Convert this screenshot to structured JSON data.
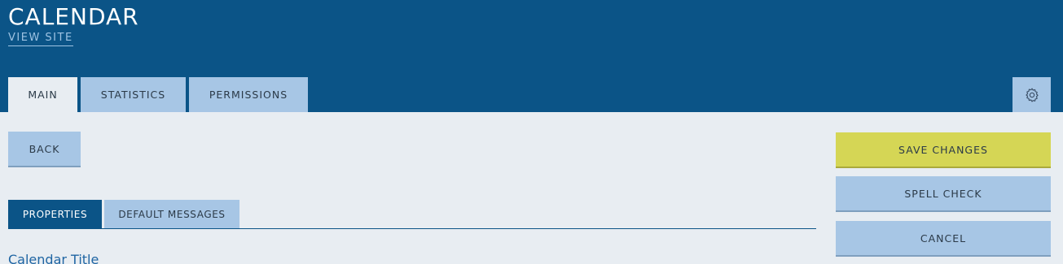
{
  "header": {
    "title": "CALENDAR",
    "view_site_label": "VIEW SITE"
  },
  "tabs": [
    {
      "label": "MAIN",
      "active": true
    },
    {
      "label": "STATISTICS",
      "active": false
    },
    {
      "label": "PERMISSIONS",
      "active": false
    }
  ],
  "settings": {
    "icon": "gear-icon"
  },
  "actions": {
    "back_label": "BACK",
    "save_label": "SAVE CHANGES",
    "spell_check_label": "SPELL CHECK",
    "cancel_label": "CANCEL"
  },
  "sub_tabs": [
    {
      "label": "PROPERTIES",
      "active": true
    },
    {
      "label": "DEFAULT MESSAGES",
      "active": false
    }
  ],
  "form": {
    "first_field_label": "Calendar Title"
  },
  "colors": {
    "header_bg": "#0b5487",
    "button_bg": "#a7c6e5",
    "save_bg": "#d5d655",
    "page_bg": "#e8edf2"
  }
}
